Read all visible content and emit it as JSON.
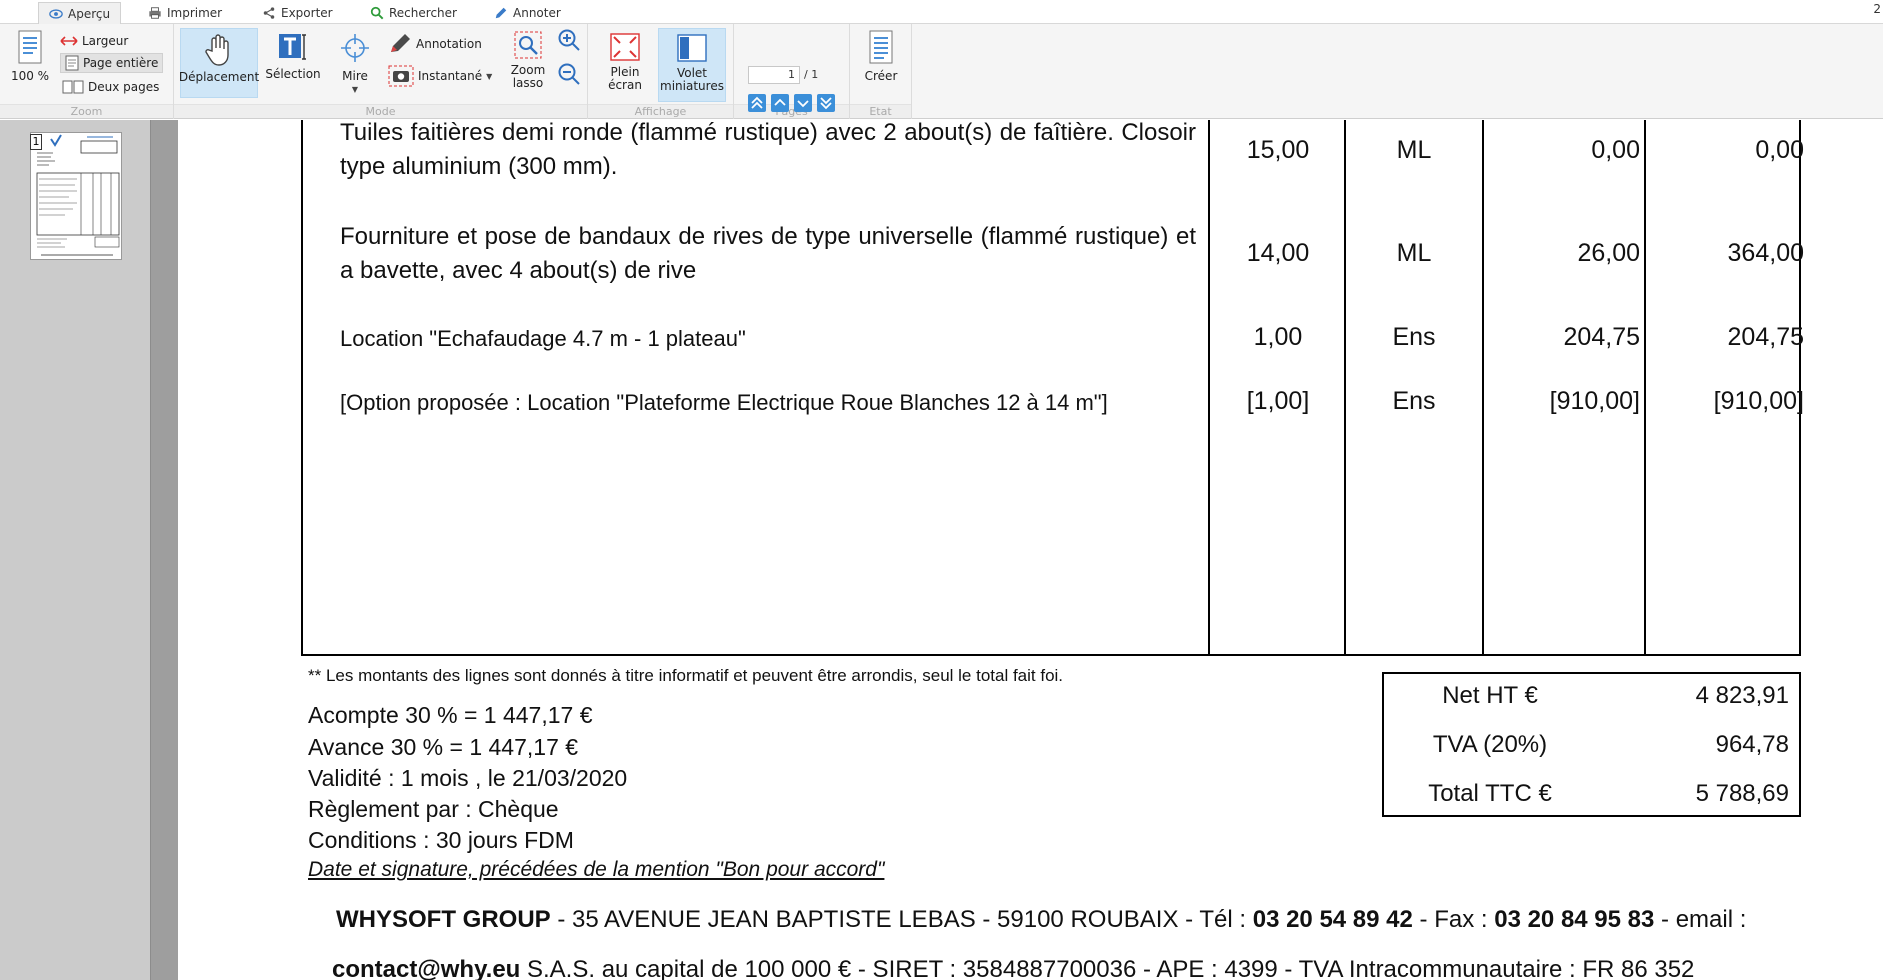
{
  "tabs": [
    {
      "label": "Aperçu",
      "icon": "eye-icon"
    },
    {
      "label": "Imprimer",
      "icon": "printer-icon"
    },
    {
      "label": "Exporter",
      "icon": "share-icon"
    },
    {
      "label": "Rechercher",
      "icon": "search-icon"
    },
    {
      "label": "Annoter",
      "icon": "pencil-icon"
    }
  ],
  "ribbon": {
    "zoom": {
      "percent_label": "100 %",
      "largeur": "Largeur",
      "page_entiere": "Page entière",
      "deux_pages": "Deux pages",
      "group_label": "Zoom"
    },
    "mode": {
      "deplacement": "Déplacement",
      "selection": "Sélection",
      "mire": "Mire",
      "annotation": "Annotation",
      "instantane": "Instantané",
      "zoom_lasso": "Zoom lasso",
      "group_label": "Mode"
    },
    "affichage": {
      "plein_ecran": "Plein écran",
      "volet_miniatures": "Volet miniatures",
      "group_label": "Affichage"
    },
    "pages": {
      "current": "1",
      "total": "/ 1",
      "group_label": "Pages"
    },
    "etat": {
      "creer": "Créer",
      "group_label": "Etat"
    }
  },
  "thumbnails": {
    "page_number": "1"
  },
  "document": {
    "rows": [
      {
        "desc": "Tuiles faitières demi ronde (flammé rustique) avec 2 about(s) de faîtière. Closoir type aluminium (300 mm).",
        "qty": "15,00",
        "unit": "ML",
        "price": "0,00",
        "total": "0,00"
      },
      {
        "desc": "Fourniture et pose de bandaux de rives de type universelle (flammé rustique) et a bavette, avec 4 about(s) de rive",
        "qty": "14,00",
        "unit": "ML",
        "price": "26,00",
        "total": "364,00"
      },
      {
        "desc": "Location \"Echafaudage 4.7 m - 1 plateau\"",
        "qty": "1,00",
        "unit": "Ens",
        "price": "204,75",
        "total": "204,75"
      },
      {
        "desc": "[Option proposée : Location \"Plateforme Electrique Roue Blanches 12 à 14 m\"]",
        "qty": "[1,00]",
        "unit": "Ens",
        "price": "[910,00]",
        "total": "[910,00]"
      }
    ],
    "note": "** Les montants des lignes sont donnés à titre informatif et peuvent être arrondis, seul le total fait foi.",
    "acompte": "Acompte 30 % =   1 447,17 €",
    "avance": "Avance 30 % =   1 447,17 €",
    "validite": "Validité : 1 mois , le 21/03/2020",
    "reglement": "Règlement par : Chèque",
    "conditions": "Conditions : 30 jours FDM",
    "signature": "Date et signature, précédées de la mention \"Bon pour accord\"",
    "totals": {
      "net_ht_label": "Net HT €",
      "net_ht": "4 823,91",
      "tva_label": "TVA (20%)",
      "tva": "964,78",
      "ttc_label": "Total TTC €",
      "ttc": "5 788,69"
    },
    "footer": {
      "company": "WHYSOFT GROUP",
      "address": " - 35 AVENUE JEAN BAPTISTE LEBAS - 59100 ROUBAIX - Tél : ",
      "tel": "03 20 54 89 42",
      "fax_label": " - Fax : ",
      "fax": "03 20 84 95 83",
      "email_label": " - email :",
      "email": "contact@why.eu",
      "line2": " S.A.S. au capital de 100 000 € - SIRET : 3584887700036 - APE : 4399 - TVA Intracommunautaire : FR 86 352"
    }
  }
}
